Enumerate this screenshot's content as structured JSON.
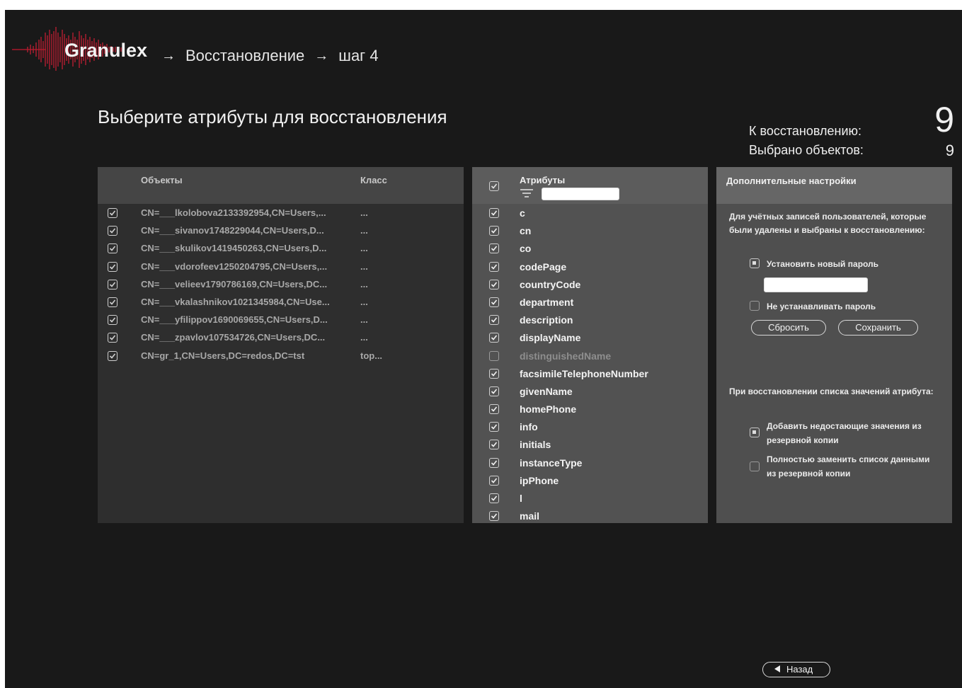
{
  "header": {
    "logo_text": "Granulex",
    "breadcrumbs": [
      "Восстановление",
      "шаг 4"
    ],
    "arrow": "→"
  },
  "page_title": "Выберите атрибуты для восстановления",
  "stats": {
    "to_restore_label": "К восстановлению:",
    "to_restore_value": "9",
    "selected_label": "Выбрано объектов:",
    "selected_value": "9"
  },
  "objects_panel": {
    "col_objects": "Объекты",
    "col_class": "Класс",
    "rows": [
      {
        "dn": "CN=___lkolobova2133392954,CN=Users,...",
        "cls": "...",
        "checked": true
      },
      {
        "dn": "CN=___sivanov1748229044,CN=Users,D...",
        "cls": "...",
        "checked": true
      },
      {
        "dn": "CN=___skulikov1419450263,CN=Users,D...",
        "cls": "...",
        "checked": true
      },
      {
        "dn": "CN=___vdorofeev1250204795,CN=Users,...",
        "cls": "...",
        "checked": true
      },
      {
        "dn": "CN=___velieev1790786169,CN=Users,DC...",
        "cls": "...",
        "checked": true
      },
      {
        "dn": "CN=___vkalashnikov1021345984,CN=Use...",
        "cls": "...",
        "checked": true
      },
      {
        "dn": "CN=___yfilippov1690069655,CN=Users,D...",
        "cls": "...",
        "checked": true
      },
      {
        "dn": "CN=___zpavlov107534726,CN=Users,DC...",
        "cls": "...",
        "checked": true
      },
      {
        "dn": "CN=gr_1,CN=Users,DC=redos,DC=tst",
        "cls": "top...",
        "checked": true
      }
    ]
  },
  "attributes_panel": {
    "header": "Атрибуты",
    "filter_placeholder": "",
    "rows": [
      {
        "name": "c",
        "checked": true
      },
      {
        "name": "cn",
        "checked": true
      },
      {
        "name": "co",
        "checked": true
      },
      {
        "name": "codePage",
        "checked": true
      },
      {
        "name": "countryCode",
        "checked": true
      },
      {
        "name": "department",
        "checked": true
      },
      {
        "name": "description",
        "checked": true
      },
      {
        "name": "displayName",
        "checked": true
      },
      {
        "name": "distinguishedName",
        "checked": false
      },
      {
        "name": "facsimileTelephoneNumber",
        "checked": true
      },
      {
        "name": "givenName",
        "checked": true
      },
      {
        "name": "homePhone",
        "checked": true
      },
      {
        "name": "info",
        "checked": true
      },
      {
        "name": "initials",
        "checked": true
      },
      {
        "name": "instanceType",
        "checked": true
      },
      {
        "name": "ipPhone",
        "checked": true
      },
      {
        "name": "l",
        "checked": true
      },
      {
        "name": "mail",
        "checked": true
      }
    ]
  },
  "settings_panel": {
    "header": "Дополнительные настройки",
    "deleted_users_text": "Для учётных записей пользователей, которые были удалены и выбраны к восстановлению:",
    "set_new_password": "Установить новый пароль",
    "password_value": "",
    "dont_set_password": "Не устанавливать пароль",
    "reset_button": "Сбросить",
    "save_button": "Сохранить",
    "list_restore_text": "При восстановлении списка значений атрибута:",
    "add_missing": "Добавить недостающие значения из резервной копии",
    "replace_list": "Полностью заменить список данными из резервной копии"
  },
  "footer": {
    "back_button": "Назад"
  }
}
